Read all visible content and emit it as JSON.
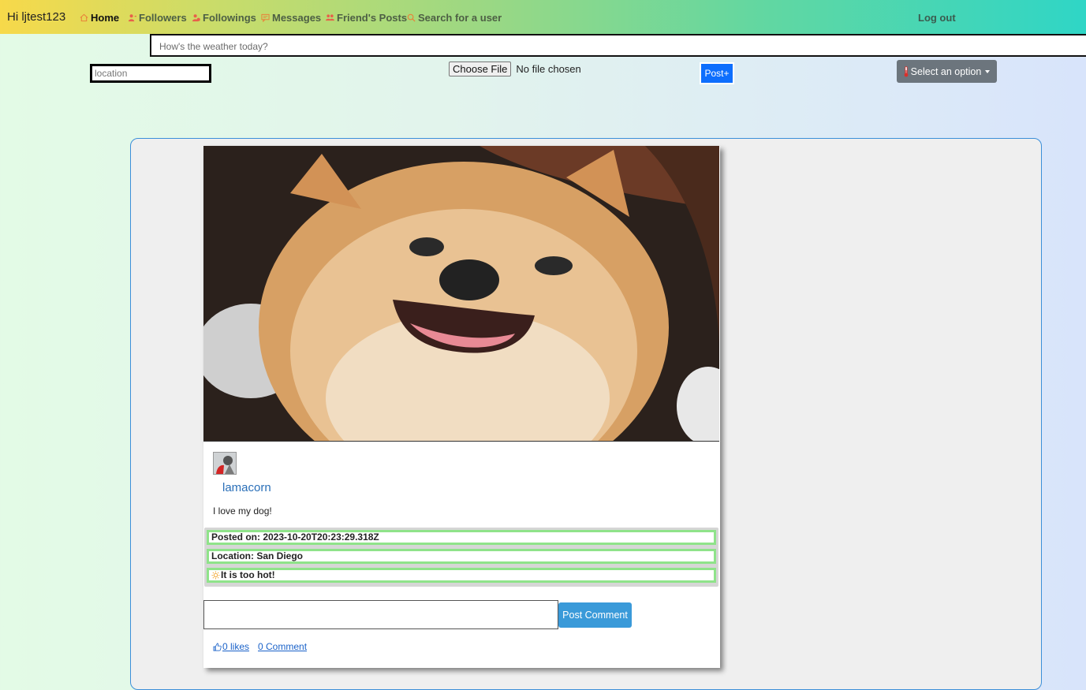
{
  "nav": {
    "brand": "Hi ljtest123",
    "items": [
      {
        "label": "Home",
        "icon": "home-icon"
      },
      {
        "label": "Followers",
        "icon": "person-icon"
      },
      {
        "label": "Followings",
        "icon": "person-add-icon"
      },
      {
        "label": "Messages",
        "icon": "message-icon"
      },
      {
        "label": "Friend's Posts",
        "icon": "people-icon"
      },
      {
        "label": "Search for a user",
        "icon": "search-icon"
      }
    ],
    "logout": "Log out"
  },
  "composer": {
    "post_placeholder": "How's the weather today?",
    "location_placeholder": "location",
    "choose_file_label": "Choose File",
    "file_status": "No file chosen",
    "post_button": "Post+",
    "select_label": "Select an option",
    "select_icon": "thermometer-icon"
  },
  "post": {
    "username": "lamacorn",
    "content": "I love my dog!",
    "posted_on": "Posted on: 2023-10-20T20:23:29.318Z",
    "location": "Location: San Diego",
    "weather_note": "It is too hot!",
    "weather_icon": "sun-icon",
    "comment_button": "Post Comment",
    "likes": "0 likes",
    "comments": "0 Comment"
  },
  "colors": {
    "accent_blue": "#0d6efd",
    "comment_button": "#3a9ad9",
    "info_border": "#8fe38a",
    "select_button": "#6c757d"
  }
}
